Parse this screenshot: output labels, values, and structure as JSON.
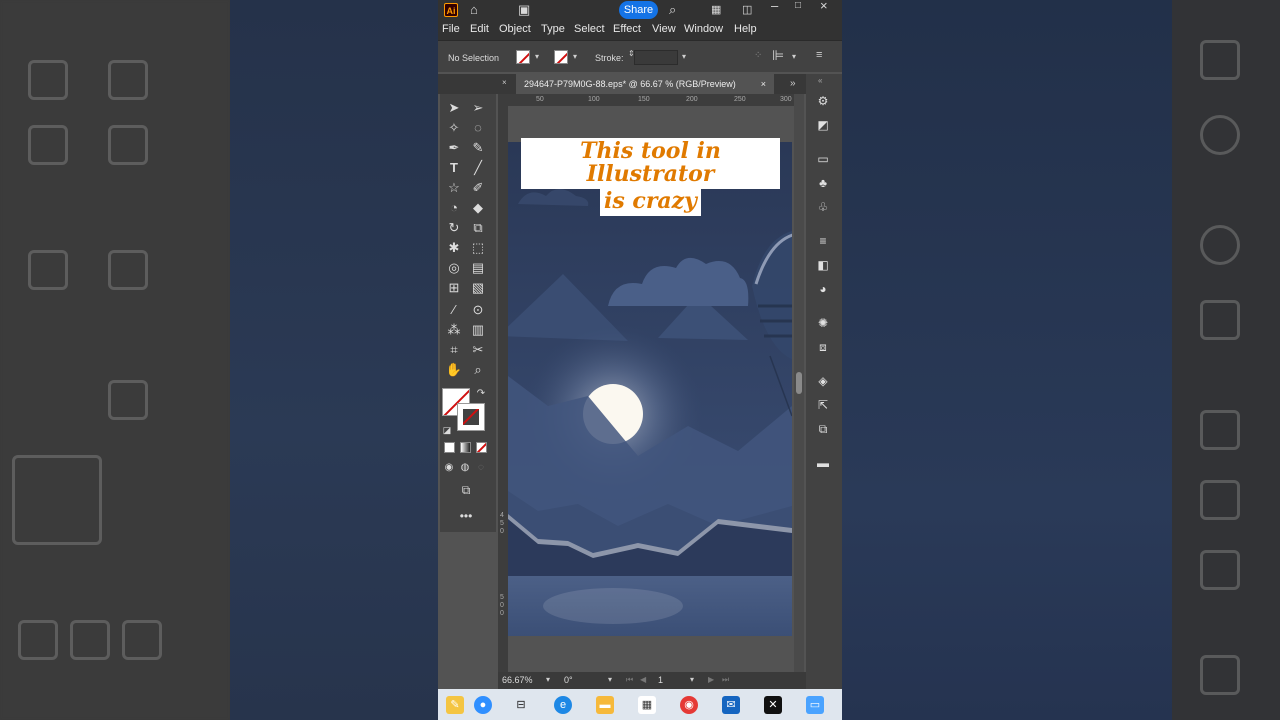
{
  "app": {
    "logo_text": "Ai",
    "share_label": "Share",
    "menu": [
      "File",
      "Edit",
      "Object",
      "Type",
      "Select",
      "Effect",
      "View",
      "Window",
      "Help"
    ]
  },
  "control_bar": {
    "selection_label": "No Selection",
    "stroke_label": "Stroke:"
  },
  "document": {
    "tab_title": "294647-P79M0G-88.eps* @ 66.67 % (RGB/Preview)",
    "close_glyph": "×",
    "ruler_top_ticks": [
      "50",
      "100",
      "150",
      "200",
      "250",
      "300"
    ],
    "ruler_left_ticks": [
      "4\n5\n0",
      "5\n0\n0"
    ]
  },
  "caption": {
    "line1": "This tool in Illustrator",
    "line2": "is crazy"
  },
  "status_bar": {
    "zoom": "66.67%",
    "rotation": "0°",
    "artboard_number": "1"
  },
  "colors": {
    "accent": "#1473e6",
    "caption_text": "#e07a00",
    "sky_top": "#2a3856",
    "sky_bottom": "#3d5179",
    "moon": "#fbf8f0"
  },
  "icons": {
    "tools": [
      "selection-tool",
      "direct-selection-tool",
      "magic-wand-tool",
      "lasso-tool",
      "pen-tool",
      "curvature-tool",
      "type-tool",
      "line-tool",
      "star-tool",
      "paintbrush-tool",
      "shaper-tool",
      "eraser-tool",
      "rotate-tool",
      "scale-tool",
      "puppet-warp-tool",
      "free-transform-tool",
      "shape-builder-tool",
      "perspective-grid-tool",
      "mesh-tool",
      "gradient-tool",
      "eyedropper-tool",
      "blend-tool",
      "symbol-sprayer-tool",
      "graph-tool",
      "artboard-tool",
      "slice-tool",
      "hand-tool",
      "zoom-tool"
    ],
    "panels": [
      "appearance-panel",
      "graphic-styles-panel",
      "color-guide-panel",
      "symbols-panel",
      "brushes-panel",
      "align-panel",
      "transparency-panel",
      "gradient-panel",
      "stroke-panel",
      "libraries-panel",
      "layers-panel",
      "export-panel",
      "artboards-panel",
      "comments-panel"
    ]
  }
}
